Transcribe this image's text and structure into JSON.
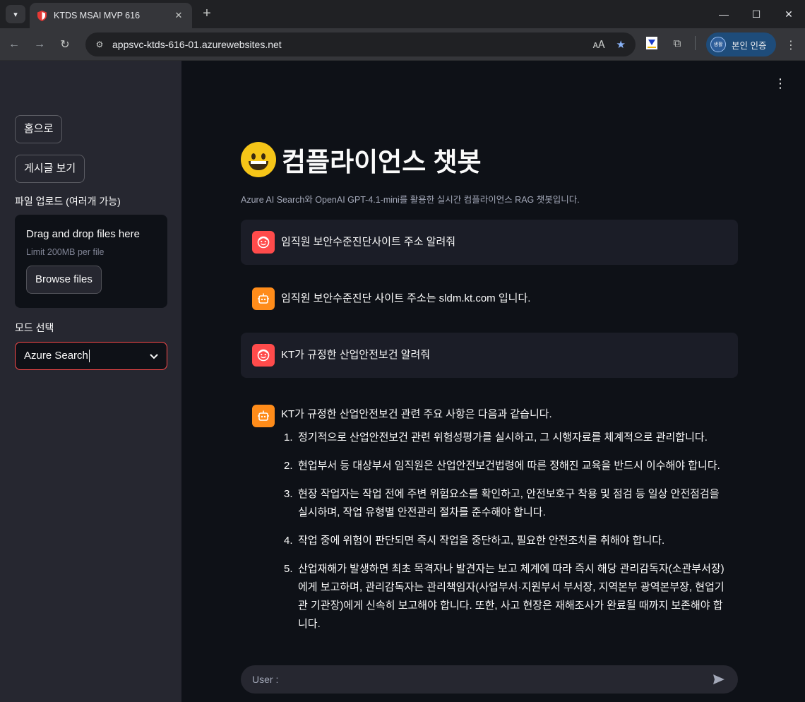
{
  "browser": {
    "tab_title": "KTDS MSAI MVP 616",
    "url": "appsvc-ktds-616-01.azurewebsites.net",
    "profile_label": "본인 인증",
    "profile_avatar": "생활"
  },
  "sidebar": {
    "home_button": "홈으로",
    "posts_button": "게시글 보기",
    "upload_label": "파일 업로드 (여러개 가능)",
    "upload_title": "Drag and drop files here",
    "upload_limit": "Limit 200MB per file",
    "browse_button": "Browse files",
    "mode_label": "모드 선택",
    "mode_value": "Azure Search"
  },
  "main": {
    "title": "컴플라이언스 챗봇",
    "subtitle": "Azure AI Search와 OpenAI GPT-4.1-mini를 활용한 실시간 컴플라이언스 RAG 챗봇입니다.",
    "messages": [
      {
        "role": "user",
        "text": "임직원 보안수준진단사이트 주소 알려줘"
      },
      {
        "role": "assistant",
        "text": "임직원 보안수준진단 사이트 주소는 sldm.kt.com 입니다."
      },
      {
        "role": "user",
        "text": "KT가 규정한 산업안전보건 알려줘"
      },
      {
        "role": "assistant",
        "text": "KT가 규정한 산업안전보건 관련 주요 사항은 다음과 같습니다."
      }
    ],
    "answer_items": [
      {
        "num": "1.",
        "text": "정기적으로 산업안전보건 관련 위험성평가를 실시하고, 그 시행자료를 체계적으로 관리합니다."
      },
      {
        "num": "2.",
        "text": "현업부서 등 대상부서 임직원은 산업안전보건법령에 따른 정해진 교육을 반드시 이수해야 합니다."
      },
      {
        "num": "3.",
        "text": "현장 작업자는 작업 전에 주변 위험요소를 확인하고, 안전보호구 착용 및 점검 등 일상 안전점검을 실시하며, 작업 유형별 안전관리 절차를 준수해야 합니다."
      },
      {
        "num": "4.",
        "text": "작업 중에 위험이 판단되면 즉시 작업을 중단하고, 필요한 안전조치를 취해야 합니다."
      },
      {
        "num": "5.",
        "text": "산업재해가 발생하면 최초 목격자나 발견자는 보고 체계에 따라 즉시 해당 관리감독자(소관부서장)에게 보고하며, 관리감독자는 관리책임자(사업부서·지원부서 부서장, 지역본부 광역본부장, 현업기관 기관장)에게 신속히 보고해야 합니다. 또한, 사고 현장은 재해조사가 완료될 때까지 보존해야 합니다."
      }
    ],
    "chat_placeholder": "User :"
  },
  "colors": {
    "accent": "#ff4b4b",
    "bot_avatar": "#ff8c1a",
    "sidebar_bg": "#262730",
    "main_bg": "#0e1117"
  }
}
